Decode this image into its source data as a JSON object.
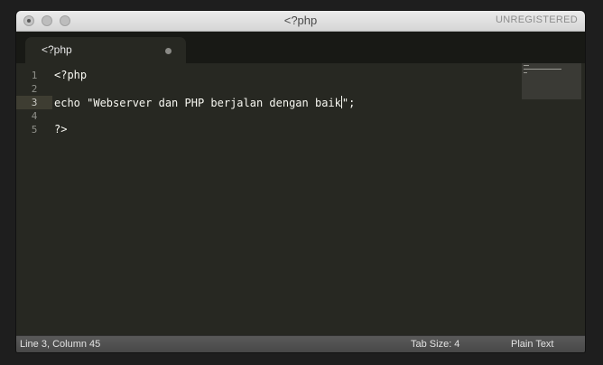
{
  "window": {
    "title": "<?php",
    "license_status": "UNREGISTERED"
  },
  "tabs": [
    {
      "label": "<?php",
      "modified": true
    }
  ],
  "editor": {
    "lines": [
      {
        "number": "1",
        "text": "<?php"
      },
      {
        "number": "2",
        "text": ""
      },
      {
        "number": "3",
        "text_before_cursor": "echo \"Webserver dan PHP berjalan dengan baik",
        "text_after_cursor": "\";"
      },
      {
        "number": "4",
        "text": ""
      },
      {
        "number": "5",
        "text": "?>"
      }
    ],
    "active_line": 3
  },
  "statusbar": {
    "position": "Line 3, Column 45",
    "tab_size": "Tab Size: 4",
    "syntax": "Plain Text"
  },
  "colors": {
    "editor_bg": "#272822",
    "tabbar_bg": "#181915",
    "text": "#f8f8f2",
    "gutter_text": "#8f908a",
    "statusbar_bg": "#4f4f4f"
  },
  "icons": {
    "close": "close-button-icon",
    "minimize": "minimize-button-icon",
    "maximize": "zoom-button-icon",
    "modified": "unsaved-dot-icon"
  }
}
